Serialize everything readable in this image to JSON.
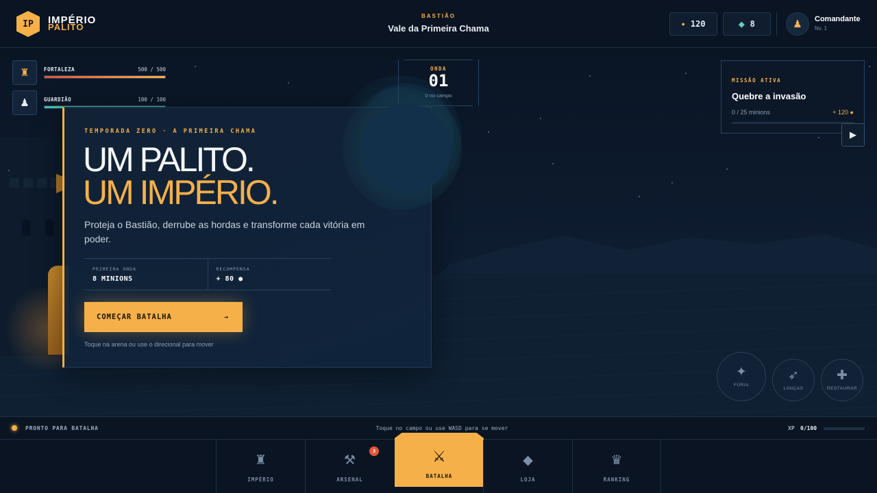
{
  "brand": {
    "badge": "IP",
    "name_line1": "IMPÉRIO",
    "name_line2": "PALITO"
  },
  "location": {
    "label": "BASTIÃO",
    "name": "Vale da Primeira Chama"
  },
  "resources": {
    "gold": "120",
    "gems": "8"
  },
  "user": {
    "name": "Comandante",
    "level": "Nv. 1"
  },
  "hud": {
    "fortress": {
      "label": "FORTALEZA",
      "value": "500 / 500",
      "fraction": 1.0
    },
    "guardian": {
      "label": "GUARDIÃO",
      "value": "100 / 100",
      "fraction": 1.0
    }
  },
  "wave": {
    "label": "ONDA",
    "number": "01",
    "sub": "0 no campo"
  },
  "mission": {
    "label": "MISSÃO ATIVA",
    "title": "Quebre a invasão",
    "progress": "0 / 25 minions",
    "reward": "+ 120 ●",
    "fraction": 0.0
  },
  "hero": {
    "season": "TEMPORADA ZERO · A PRIMEIRA CHAMA",
    "headline1": "UM PALITO.",
    "headline2": "UM IMPÉRIO.",
    "description": "Proteja o Bastião, derrube as hordas e transforme cada vitória em poder.",
    "stats": [
      {
        "label": "PRIMEIRA ONDA",
        "value": "8 MINIONS"
      },
      {
        "label": "RECOMPENSA",
        "value": "+ 80 ●"
      }
    ],
    "cta": "COMEÇAR BATALHA",
    "cta_arrow": "→",
    "hint": "Toque na arena ou use o direcional para mover"
  },
  "abilities": [
    {
      "icon": "✦",
      "icon_name": "spark-icon",
      "label": "FÚRIA"
    },
    {
      "icon": "➶",
      "icon_name": "spear-icon",
      "label": "LANÇAS"
    },
    {
      "icon": "✚",
      "icon_name": "plus-icon",
      "label": "RESTAURAR"
    }
  ],
  "status": {
    "text": "PRONTO PARA BATALHA",
    "hint": "Toque no campo ou use WASD para se mover",
    "xp_label": "XP",
    "xp_value": "0/100",
    "xp_fraction": 0.0
  },
  "nav": [
    {
      "icon": "♜",
      "icon_name": "castle-icon",
      "label": "IMPÉRIO"
    },
    {
      "icon": "⚒",
      "icon_name": "hammer-icon",
      "label": "ARSENAL",
      "badge": "3"
    },
    {
      "icon": "⚔",
      "icon_name": "swords-icon",
      "label": "BATALHA",
      "active": true
    },
    {
      "icon": "◆",
      "icon_name": "diamond-icon",
      "label": "LOJA"
    },
    {
      "icon": "♛",
      "icon_name": "crown-icon",
      "label": "RANKING"
    }
  ],
  "colors": {
    "accent": "#f5b04a",
    "background": "#0b1626",
    "health": "#e2553b",
    "guardian": "#49c0aa",
    "gem": "#5fd0c0"
  }
}
